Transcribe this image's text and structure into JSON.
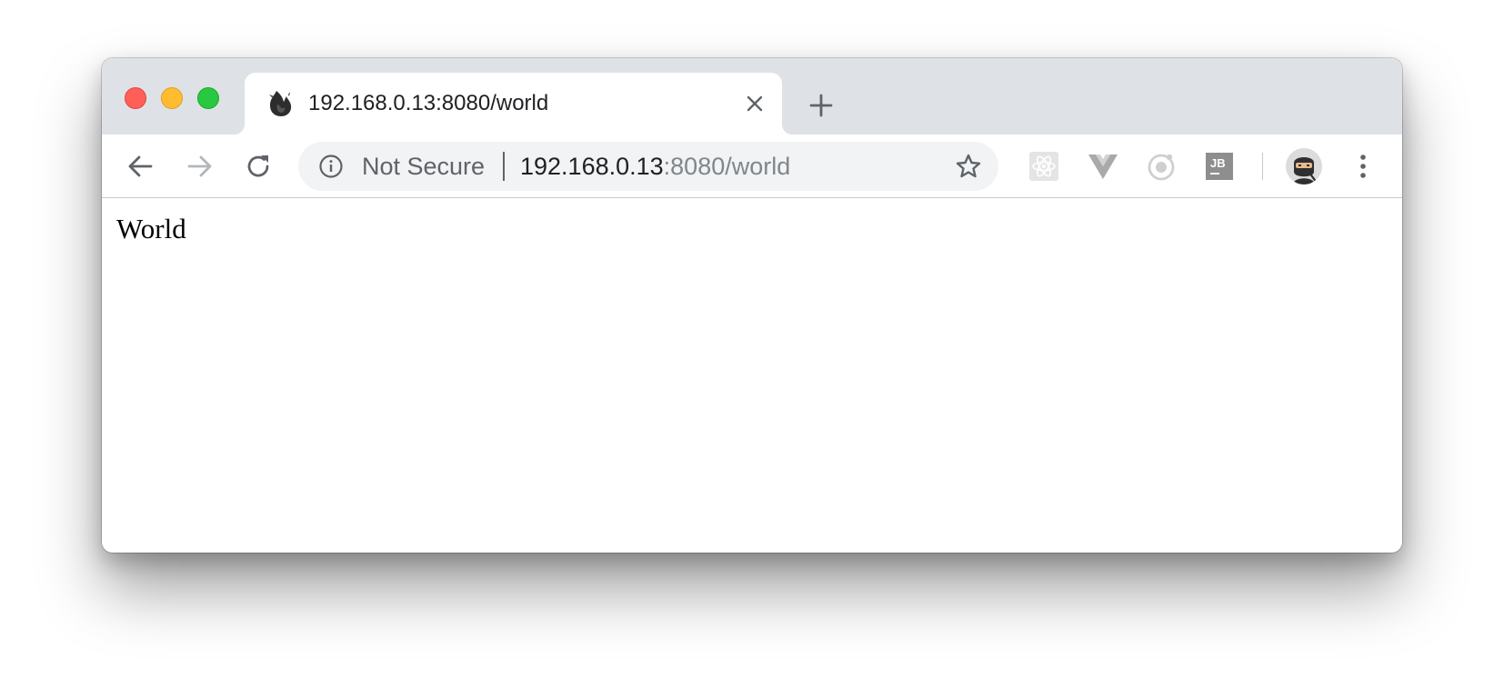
{
  "window": {
    "controls": [
      "close",
      "minimize",
      "maximize"
    ],
    "colors": {
      "close": "#ff5f57",
      "minimize": "#febc2e",
      "maximize": "#28c840"
    }
  },
  "tab": {
    "title": "192.168.0.13:8080/world",
    "favicon": "flame-icon",
    "close_icon": "close-icon"
  },
  "new_tab_icon": "plus-icon",
  "toolbar": {
    "back_icon": "arrow-left-icon",
    "forward_icon": "arrow-right-icon",
    "reload_icon": "reload-icon",
    "omnibox": {
      "security_icon": "info-icon",
      "security_label": "Not Secure",
      "url_host": "192.168.0.13",
      "url_rest": ":8080/world",
      "bookmark_icon": "star-icon"
    },
    "extensions": [
      "react-devtools-icon",
      "vue-devtools-icon",
      "ionic-icon",
      "jetbrains-icon"
    ],
    "profile_icon": "ninja-avatar-icon",
    "menu_icon": "more-vertical-icon"
  },
  "page": {
    "text": "World"
  }
}
